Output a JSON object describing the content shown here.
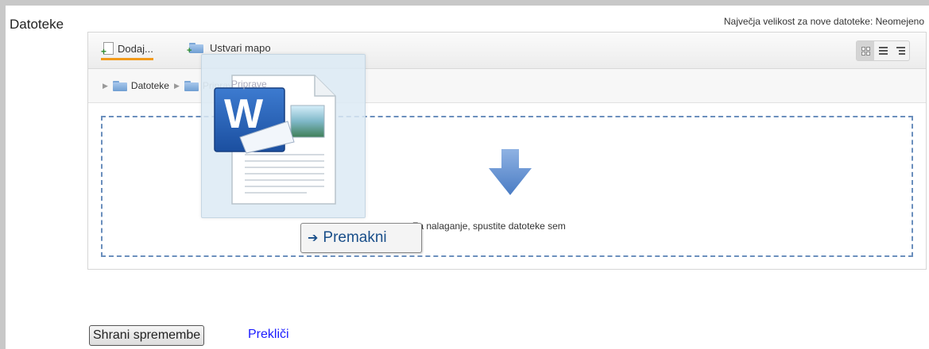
{
  "field": {
    "label": "Datoteke",
    "max_size": "Največja velikost za nove datoteke: Neomejeno"
  },
  "toolbar": {
    "add_label": "Dodaj...",
    "mkdir_label": "Ustvari mapo",
    "views": [
      "icons-view-icon",
      "list-view-icon",
      "tree-view-icon"
    ],
    "active_view": "icons"
  },
  "breadcrumb": {
    "root": "Datoteke",
    "current": "Priprave"
  },
  "dropzone": {
    "text": "Za nalaganje, spustite datoteke sem"
  },
  "drag": {
    "file_icon": "word-document-icon",
    "tooltip": "Premakni"
  },
  "form": {
    "save_label": "Shrani spremembe",
    "cancel_label": "Prekliči"
  },
  "colors": {
    "accent_underline": "#f29a1a",
    "dropzone_border": "#6b8fbd",
    "link": "#1a1aff"
  }
}
